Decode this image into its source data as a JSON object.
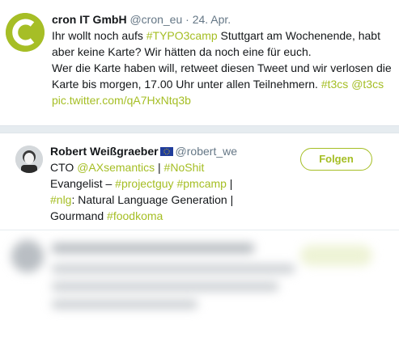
{
  "tweet": {
    "author_name": "cron IT GmbH",
    "handle": "@cron_eu",
    "separator": "·",
    "date": "24. Apr.",
    "text_parts": [
      "Ihr wollt noch aufs ",
      "#TYPO3camp",
      " Stuttgart am Wochenende, habt aber keine Karte? Wir hätten da noch eine für euch.",
      "Wer die Karte haben will, retweet diesen Tweet und wir verlosen die Karte bis morgen, 17.00 Uhr unter allen Teilnehmern. ",
      "#t3cs",
      " ",
      "@t3cs",
      "pic.twitter.com/qA7HxNtq3b"
    ],
    "avatar_icon": "cron-logo-icon"
  },
  "profile": {
    "name": "Robert Weißgraeber",
    "flag_icon": "eu-flag-icon",
    "handle": "@robert_we",
    "follow_label": "Folgen",
    "bio_parts": [
      "CTO ",
      "@AXsemantics",
      " | ",
      "#NoShit",
      "Evangelist – ",
      "#projectguy",
      " ",
      "#pmcamp",
      " |",
      "#nlg",
      ": Natural Language Generation |",
      "Gourmand ",
      "#foodkoma"
    ]
  },
  "colors": {
    "accent": "#a5be24",
    "text": "#14171a",
    "muted": "#657786",
    "divider": "#e6ecf0"
  }
}
